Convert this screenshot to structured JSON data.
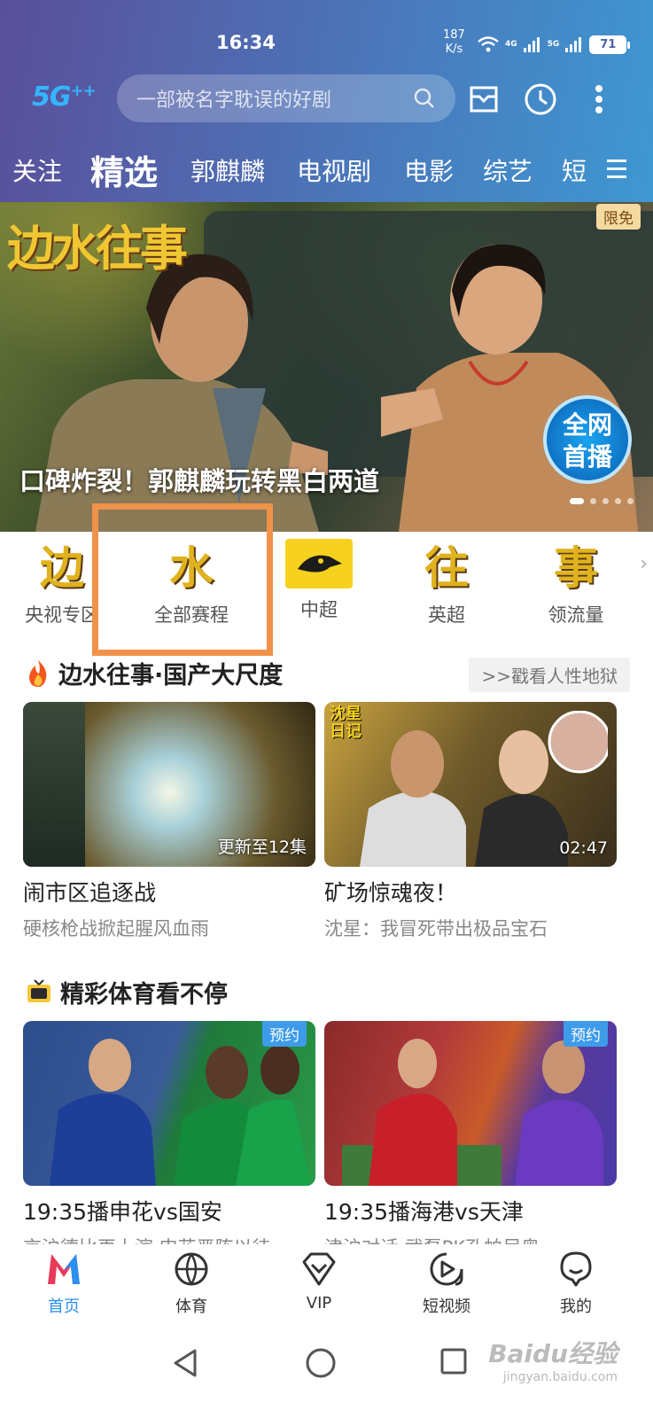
{
  "status_bar": {
    "time": "16:34",
    "net_speed_value": "187",
    "net_speed_unit": "K/s",
    "battery": "71",
    "signal1": "4G",
    "signal2": "5G"
  },
  "top_bar": {
    "logo": "5G",
    "logo_sup": "++",
    "search_placeholder": "一部被名字耽误的好剧"
  },
  "tabs": [
    "关注",
    "精选",
    "郭麒麟",
    "电视剧",
    "电影",
    "综艺",
    "短"
  ],
  "banner": {
    "title_art": "边水往事",
    "badge": "限免",
    "premiere_line1": "全网",
    "premiere_line2": "首播",
    "caption": "口碑炸裂！郭麒麟玩转黑白两道"
  },
  "quick_entries": [
    {
      "label": "央视专区",
      "icon_text": "边"
    },
    {
      "label": "全部赛程",
      "icon_text": "水"
    },
    {
      "label": "中超",
      "icon_text": ""
    },
    {
      "label": "英超",
      "icon_text": "往"
    },
    {
      "label": "领流量",
      "icon_text": "事"
    }
  ],
  "section1": {
    "title": "边水往事·国产大尺度",
    "more": ">>戳看人性地狱",
    "cards": [
      {
        "thumb_text": "更新至12集",
        "title": "闹市区追逐战",
        "subtitle": "硬核枪战掀起腥风血雨"
      },
      {
        "thumb_text": "02:47",
        "title": "矿场惊魂夜！",
        "subtitle": "沈星：我冒死带出极品宝石",
        "tag": "沈星日记"
      }
    ]
  },
  "section2": {
    "title": "精彩体育看不停",
    "cards": [
      {
        "badge": "预约",
        "title": "19:35播申花vs国安",
        "subtitle": "京沪德比再上演 申花严阵以待"
      },
      {
        "badge": "预约",
        "title": "19:35播海港vs天津",
        "subtitle": "津沪对话 武磊PK孔帕尼奥"
      }
    ]
  },
  "bottom_nav": [
    "首页",
    "体育",
    "VIP",
    "短视频",
    "我的"
  ],
  "watermark": {
    "main": "Baidu经验",
    "sub": "jingyan.baidu.com"
  },
  "colors": {
    "accent": "#2b8ff0",
    "highlight": "#f0924a",
    "header_start": "#5a4f9a",
    "header_end": "#3e98d2"
  }
}
